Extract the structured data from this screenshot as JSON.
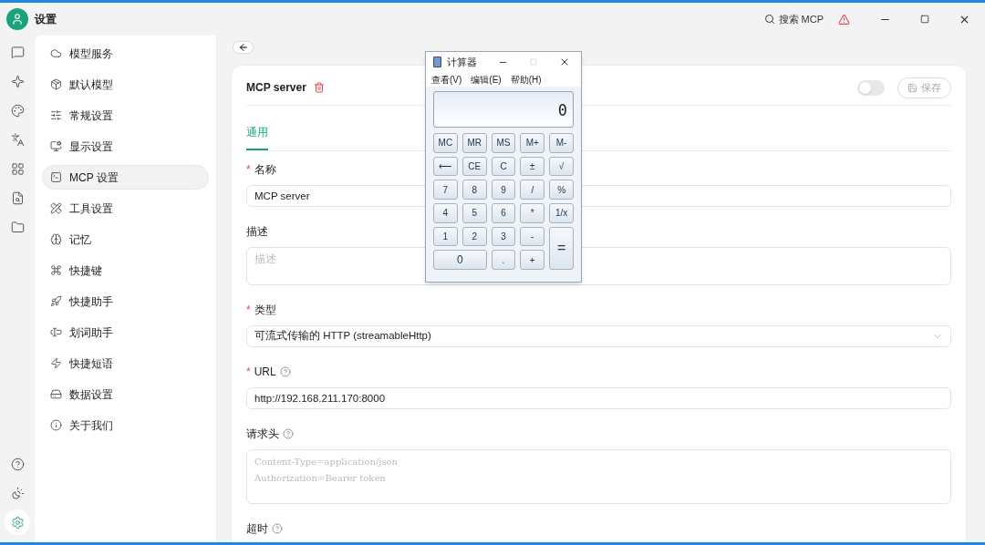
{
  "window": {
    "title": "设置",
    "search": "搜索 MCP"
  },
  "rail": {
    "top": [
      {
        "kind": "chat",
        "selected": false
      },
      {
        "kind": "sparkle",
        "selected": false
      },
      {
        "kind": "palette",
        "selected": false
      },
      {
        "kind": "translate",
        "selected": false
      },
      {
        "kind": "apps",
        "selected": false
      },
      {
        "kind": "file-search",
        "selected": false
      },
      {
        "kind": "folder",
        "selected": false
      }
    ],
    "bottom": [
      {
        "kind": "help",
        "selected": false
      },
      {
        "kind": "theme",
        "selected": false
      },
      {
        "kind": "settings",
        "selected": true
      }
    ]
  },
  "nav": [
    {
      "label": "模型服务",
      "kind": "cloud",
      "selected": false
    },
    {
      "label": "默认模型",
      "kind": "package",
      "selected": false
    },
    {
      "label": "常规设置",
      "kind": "sliders",
      "selected": false
    },
    {
      "label": "显示设置",
      "kind": "monitor",
      "selected": false
    },
    {
      "label": "MCP 设置",
      "kind": "terminal",
      "selected": true
    },
    {
      "label": "工具设置",
      "kind": "tools",
      "selected": false
    },
    {
      "label": "记忆",
      "kind": "brain",
      "selected": false
    },
    {
      "label": "快捷键",
      "kind": "command",
      "selected": false
    },
    {
      "label": "快捷助手",
      "kind": "rocket",
      "selected": false
    },
    {
      "label": "划词助手",
      "kind": "cursor",
      "selected": false
    },
    {
      "label": "快捷短语",
      "kind": "zap",
      "selected": false
    },
    {
      "label": "数据设置",
      "kind": "drive",
      "selected": false
    },
    {
      "label": "关于我们",
      "kind": "info",
      "selected": false
    }
  ],
  "editor": {
    "title": "MCP server",
    "enabled": false,
    "save": "保存",
    "tabs": [
      {
        "label": "通用",
        "selected": true
      }
    ],
    "fields": [
      {
        "kind": "input",
        "label": "名称",
        "required": true,
        "help": false,
        "value": "MCP server"
      },
      {
        "kind": "textarea",
        "label": "描述",
        "required": false,
        "help": false,
        "placeholder": "描述"
      },
      {
        "kind": "select",
        "label": "类型",
        "required": true,
        "help": false,
        "value": "可流式传输的 HTTP (streamableHttp)"
      },
      {
        "kind": "input",
        "label": "URL",
        "required": true,
        "help": true,
        "value": "http://192.168.211.170:8000"
      },
      {
        "kind": "code",
        "label": "请求头",
        "required": false,
        "help": true,
        "placeholder": "Content-Type=application/json\nAuthorization=Bearer token"
      },
      {
        "kind": "label",
        "label": "超时",
        "required": false,
        "help": true
      }
    ]
  },
  "calculator": {
    "title": "计算器",
    "menu": [
      "查看(V)",
      "编辑(E)",
      "帮助(H)"
    ],
    "display": "0",
    "keys": [
      {
        "label": "MC",
        "kind": "normal"
      },
      {
        "label": "MR",
        "kind": "normal"
      },
      {
        "label": "MS",
        "kind": "normal"
      },
      {
        "label": "M+",
        "kind": "normal"
      },
      {
        "label": "M-",
        "kind": "normal"
      },
      {
        "label": "⟵",
        "kind": "normal"
      },
      {
        "label": "CE",
        "kind": "normal"
      },
      {
        "label": "C",
        "kind": "normal"
      },
      {
        "label": "±",
        "kind": "normal"
      },
      {
        "label": "√",
        "kind": "normal"
      },
      {
        "label": "7",
        "kind": "normal"
      },
      {
        "label": "8",
        "kind": "normal"
      },
      {
        "label": "9",
        "kind": "normal"
      },
      {
        "label": "/",
        "kind": "normal"
      },
      {
        "label": "%",
        "kind": "normal"
      },
      {
        "label": "4",
        "kind": "normal"
      },
      {
        "label": "5",
        "kind": "normal"
      },
      {
        "label": "6",
        "kind": "normal"
      },
      {
        "label": "*",
        "kind": "normal"
      },
      {
        "label": "1/x",
        "kind": "normal"
      },
      {
        "label": "1",
        "kind": "normal"
      },
      {
        "label": "2",
        "kind": "normal"
      },
      {
        "label": "3",
        "kind": "normal"
      },
      {
        "label": "-",
        "kind": "normal"
      },
      {
        "label": "=",
        "kind": "tall"
      },
      {
        "label": "0",
        "kind": "wide"
      },
      {
        "label": ".",
        "kind": "normal"
      },
      {
        "label": "+",
        "kind": "normal"
      }
    ]
  }
}
